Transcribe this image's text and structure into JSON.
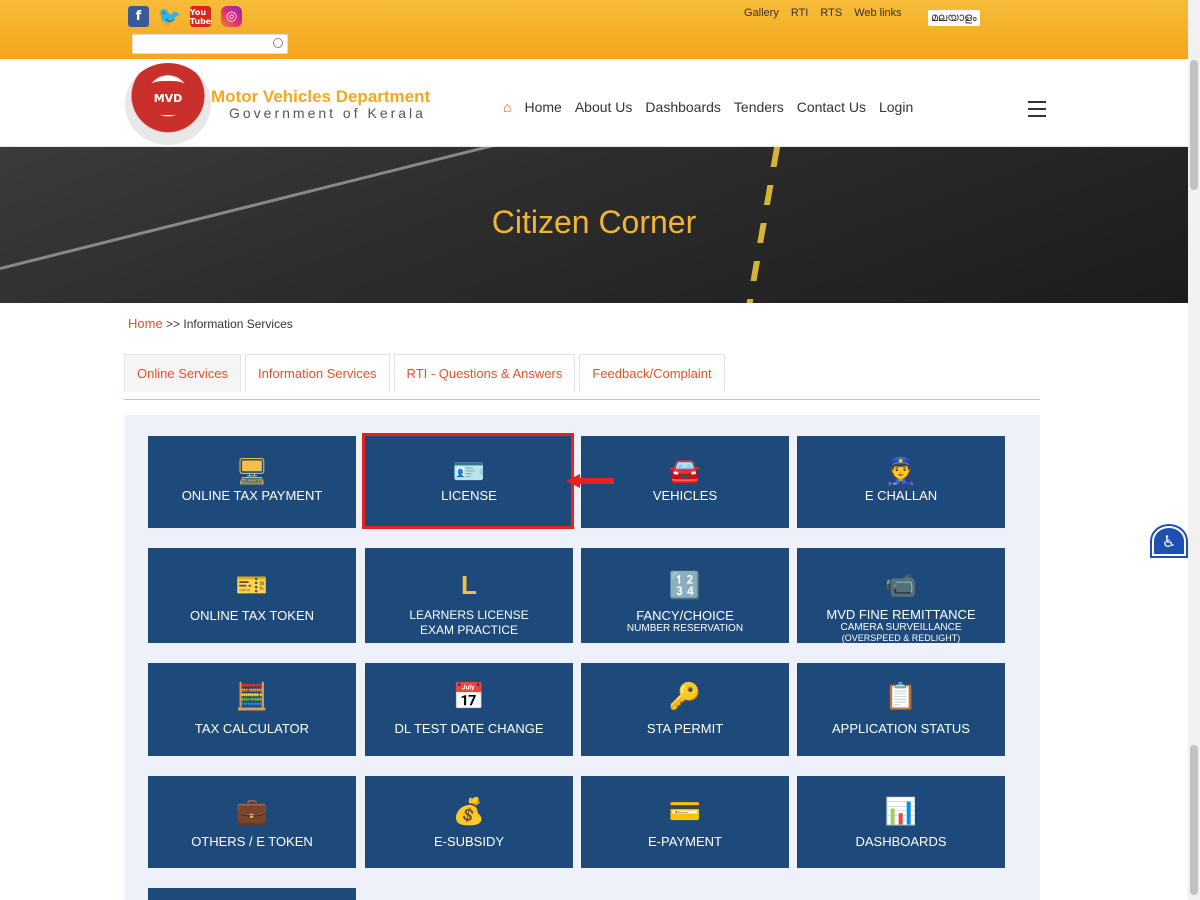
{
  "social": [
    "f",
    "t",
    "You Tube",
    "ig"
  ],
  "toplinks": [
    "Gallery",
    "RTI",
    "RTS",
    "Web links"
  ],
  "lang": "മലയാളം",
  "org": {
    "name": "Motor Vehicles Department",
    "sub": "Government of Kerala",
    "logo_text": "MVD"
  },
  "nav": [
    "Home",
    "About Us",
    "Dashboards",
    "Tenders",
    "Contact Us",
    "Login"
  ],
  "hero_title": "Citizen Corner",
  "breadcrumb": {
    "home": "Home",
    "sep": ">>",
    "current": "Information Services"
  },
  "tabs": [
    "Online Services",
    "Information Services",
    "RTI - Questions & Answers",
    "Feedback/Complaint"
  ],
  "tiles": [
    {
      "label": "ONLINE TAX PAYMENT",
      "icon": "computer-icon"
    },
    {
      "label": "LICENSE",
      "icon": "license-card-icon"
    },
    {
      "label": "VEHICLES",
      "icon": "garage-icon"
    },
    {
      "label": "E CHALLAN",
      "icon": "officer-icon"
    },
    {
      "label": "ONLINE TAX TOKEN",
      "icon": "ticket-icon"
    },
    {
      "label": "LEARNERS LICENSE",
      "sub": "EXAM PRACTICE",
      "icon": "learner-L-icon"
    },
    {
      "label": "FANCY/CHOICE",
      "sub": "NUMBER RESERVATION",
      "icon": "number-plate-icon"
    },
    {
      "label": "MVD FINE REMITTANCE",
      "sub": "CAMERA SURVEILLANCE",
      "sub2": "(OVERSPEED & REDLIGHT)",
      "icon": "camera-icon"
    },
    {
      "label": "TAX CALCULATOR",
      "icon": "calculator-icon"
    },
    {
      "label": "DL TEST DATE CHANGE",
      "icon": "calendar-icon"
    },
    {
      "label": "STA PERMIT",
      "icon": "permit-icon"
    },
    {
      "label": "APPLICATION STATUS",
      "icon": "status-icon"
    },
    {
      "label": "OTHERS / E TOKEN",
      "icon": "briefcase-icon"
    },
    {
      "label": "E-SUBSIDY",
      "icon": "money-bag-icon"
    },
    {
      "label": "E-PAYMENT",
      "icon": "card-payment-icon"
    },
    {
      "label": "DASHBOARDS",
      "icon": "dashboard-icon"
    }
  ]
}
